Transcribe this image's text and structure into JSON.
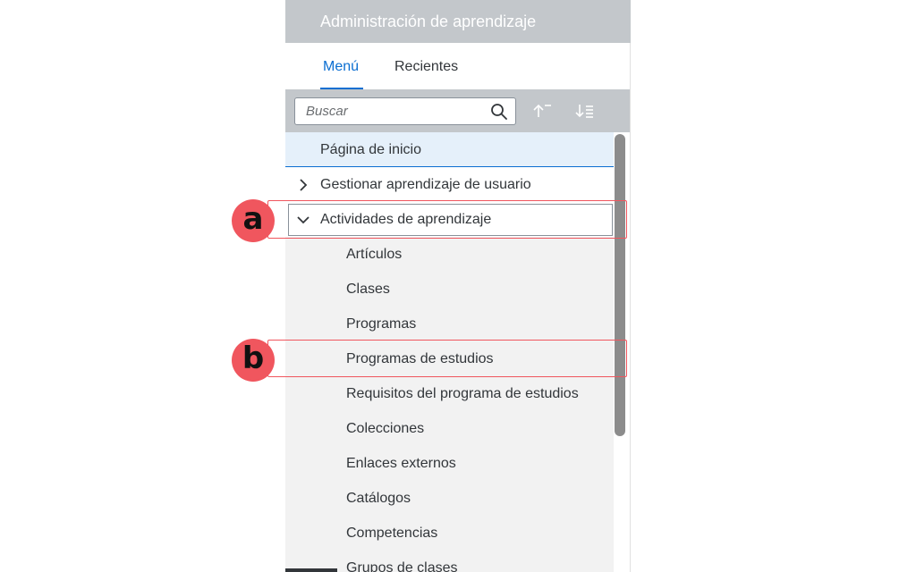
{
  "header": {
    "title": "Administración de aprendizaje"
  },
  "tabs": [
    {
      "label": "Menú",
      "active": true
    },
    {
      "label": "Recientes",
      "active": false
    }
  ],
  "search": {
    "placeholder": "Buscar",
    "icon": "search-icon"
  },
  "toolbar": {
    "sort_ascending_icon": "sort-ascending-icon",
    "sort_list_icon": "sort-list-icon"
  },
  "menu": {
    "home": "Página de inicio",
    "items": [
      {
        "label": "Gestionar aprendizaje de usuario",
        "expanded": false
      },
      {
        "label": "Actividades de aprendizaje",
        "expanded": true
      }
    ],
    "subitems": [
      "Artículos",
      "Clases",
      "Programas",
      "Programas de estudios",
      "Requisitos del programa de estudios",
      "Colecciones",
      "Enlaces externos",
      "Catálogos",
      "Competencias",
      "Grupos de clases"
    ]
  },
  "annotations": {
    "a": "a",
    "b": "b"
  },
  "colors": {
    "accent": "#0a6ed1",
    "header_bg": "#c3c7cb",
    "callout": "#f0565e"
  }
}
